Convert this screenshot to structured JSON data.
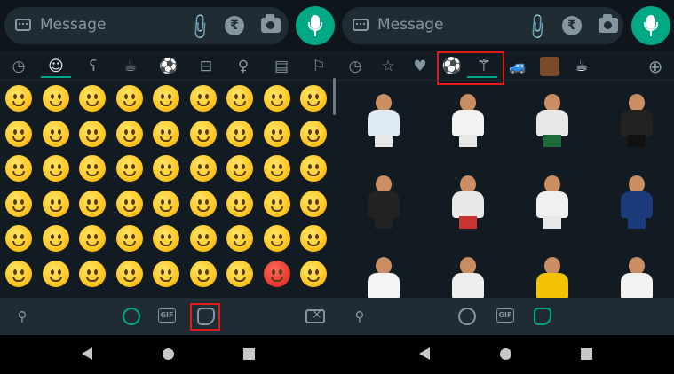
{
  "composer": {
    "placeholder": "Message"
  },
  "left_tabs": [
    "recent-icon",
    "smileys-icon",
    "animals-icon",
    "food-icon",
    "activity-icon",
    "travel-icon",
    "objects-icon",
    "symbols-icon",
    "flags-icon"
  ],
  "right_tabs": [
    "recent-icon",
    "favorites-icon",
    "heart-icon",
    "sticker-pack-football-icon",
    "sticker-pack-eagle-icon",
    "sticker-pack-beetle-icon",
    "sticker-pack-portrait-icon",
    "sticker-pack-coffee-icon",
    "add-pack-icon"
  ],
  "gif_label": "GIF",
  "emoji_rows": 6,
  "emoji_cols": 9,
  "sticker_rows": 3,
  "sticker_cols": 4,
  "colors": {
    "accent": "#00a884",
    "highlight": "#e21a1a",
    "panel": "#121b22"
  }
}
